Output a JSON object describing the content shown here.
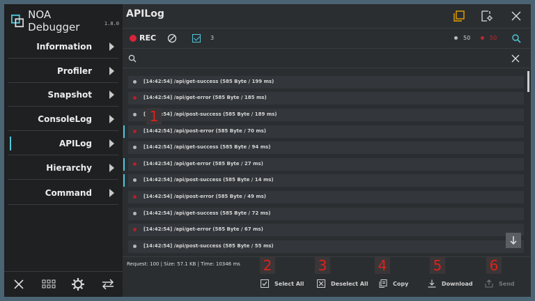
{
  "brand": {
    "name": "NOA Debugger",
    "version": "1.8.0"
  },
  "sidebar": {
    "items": [
      {
        "label": "Information"
      },
      {
        "label": "Profiler"
      },
      {
        "label": "Snapshot"
      },
      {
        "label": "ConsoleLog"
      },
      {
        "label": "APILog",
        "active": true
      },
      {
        "label": "Hierarchy"
      },
      {
        "label": "Command"
      }
    ],
    "footer_icons": [
      "close-icon",
      "grid-icon",
      "gear-icon",
      "swap-icon"
    ]
  },
  "header": {
    "title": "APILog",
    "icons": [
      "window-icon",
      "settings-panel-icon",
      "close-icon"
    ]
  },
  "toolbar": {
    "rec_label": "REC",
    "selected_count": "3",
    "success_count": "50",
    "error_count": "50"
  },
  "search": {
    "placeholder": ""
  },
  "logs": [
    {
      "text": "[14:42:54] /api/get-success (585 Byte / 199 ms)",
      "status": "ok"
    },
    {
      "text": "[14:42:54] /api/get-error (585 Byte / 185 ms)",
      "status": "err"
    },
    {
      "text": "[14:42:54] /api/post-success (585 Byte / 189 ms)",
      "status": "ok"
    },
    {
      "text": "[14:42:54] /api/post-error (585 Byte / 70 ms)",
      "status": "err",
      "selected": true
    },
    {
      "text": "[14:42:54] /api/get-success (585 Byte / 94 ms)",
      "status": "ok"
    },
    {
      "text": "[14:42:54] /api/get-error (585 Byte / 27 ms)",
      "status": "err",
      "selected": true
    },
    {
      "text": "[14:42:54] /api/post-success (585 Byte / 14 ms)",
      "status": "ok",
      "selected": true
    },
    {
      "text": "[14:42:54] /api/post-error (585 Byte / 49 ms)",
      "status": "err"
    },
    {
      "text": "[14:42:54] /api/get-success (585 Byte / 72 ms)",
      "status": "ok"
    },
    {
      "text": "[14:42:54] /api/get-error (585 Byte / 67 ms)",
      "status": "err"
    },
    {
      "text": "[14:42:54] /api/post-success (585 Byte / 55 ms)",
      "status": "ok"
    }
  ],
  "footer": {
    "stats": "Request: 100 | Size: 57.1 KB | Time: 10346 ms",
    "select_all": "Select All",
    "deselect_all": "Deselect All",
    "copy": "Copy",
    "download": "Download",
    "send": "Send"
  },
  "annotations": [
    "1",
    "2",
    "3",
    "4",
    "5",
    "6"
  ],
  "colors": {
    "accent": "#4fc7dc",
    "error": "#c0262f",
    "rec": "#d9233a",
    "highlight": "#e8a400"
  }
}
